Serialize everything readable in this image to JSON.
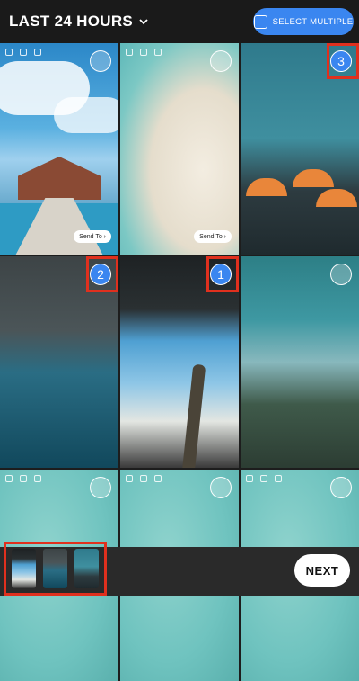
{
  "header": {
    "title": "LAST 24 HOURS",
    "select_multiple_label": "SELECT MULTIPLE"
  },
  "selection_badges": [
    "3",
    "2",
    "1"
  ],
  "story_action": {
    "send_to_label": "Send To"
  },
  "footer": {
    "next_label": "NEXT"
  },
  "colors": {
    "accent": "#3a86f0",
    "highlight": "#e0301e"
  }
}
